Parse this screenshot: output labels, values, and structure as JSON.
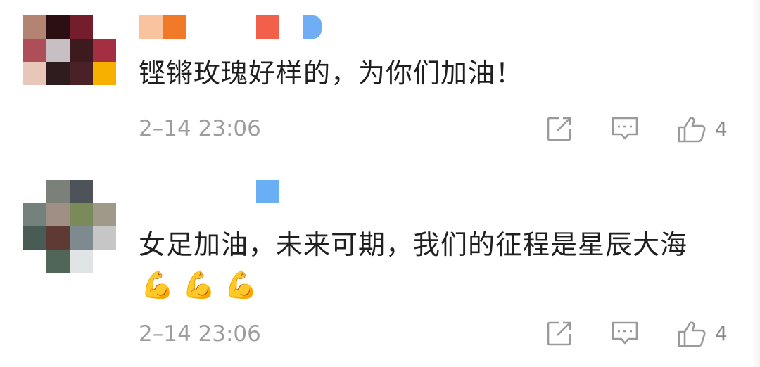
{
  "comments": [
    {
      "text": "铿锵玫瑰好样的，为你们加油！",
      "emoji": "",
      "timestamp": "2–14 23:06",
      "like_count": "4",
      "avatar_colors": [
        "#b38472",
        "#2b0f12",
        "#751d2c",
        "#ffffff",
        "#ad4e58",
        "#c7bfc4",
        "#3d1a1e",
        "#a42f41",
        "#e7c8b8",
        "#2f1c1e",
        "#4a2127",
        "#f7b000"
      ],
      "name_colors": [
        "#f9c3a0",
        "#f07a28",
        "#f2604c",
        "#6faef5"
      ]
    },
    {
      "text": "女足加油，未来可期，我们的征程是星辰大海",
      "emoji": "💪💪💪",
      "timestamp": "2–14 23:06",
      "like_count": "4",
      "avatar_colors": [
        "#ffffff",
        "#7b8079",
        "#4d5359",
        "#ffffff",
        "#75817d",
        "#a08f84",
        "#7b8a5b",
        "#9f998a",
        "#495c54",
        "#5f3a34",
        "#7d8b91",
        "#c6c6c6",
        "#ffffff",
        "#4f6659",
        "#e0e4e5",
        "#ffffff"
      ],
      "name_colors": [
        "#6aaef5"
      ]
    }
  ]
}
